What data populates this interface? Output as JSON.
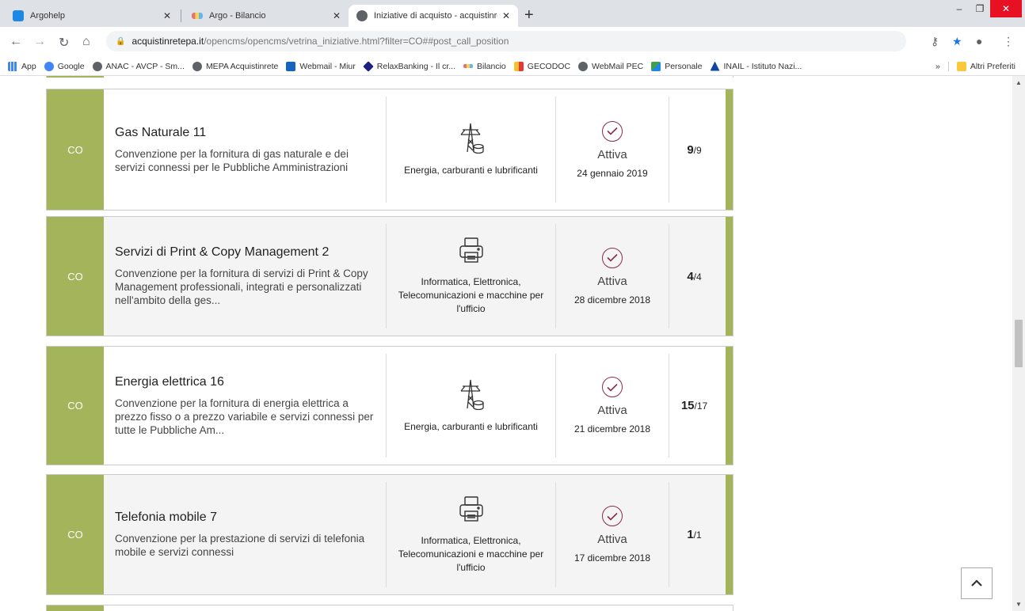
{
  "browser": {
    "tabs": [
      {
        "title": "Argohelp",
        "active": false
      },
      {
        "title": "Argo - Bilancio",
        "active": false
      },
      {
        "title": "Iniziative di acquisto - acquistinre",
        "active": true
      }
    ],
    "new_tab": "+",
    "url_host": "acquistinretepa.it",
    "url_path": "/opencms/opencms/vetrina_iniziative.html?filter=CO##post_call_position",
    "bookmarks": [
      "App",
      "Google",
      "ANAC - AVCP - Sm...",
      "MEPA Acquistinrete",
      "Webmail - Miur",
      "RelaxBanking - Il cr...",
      "Bilancio",
      "GECODOC",
      "WebMail PEC",
      "Personale",
      "INAIL - Istituto Nazi...",
      "Altri Preferiti"
    ],
    "bookmarks_overflow": "»"
  },
  "cards": [
    {
      "badge": "CO",
      "title": "Gas Naturale 11",
      "desc": "Convenzione per la fornitura di gas naturale e dei servizi connessi per le Pubbliche Amministrazioni",
      "category": "Energia, carburanti e lubrificanti",
      "category_icon": "electricity-pylon-icon",
      "status": "Attiva",
      "date": "24 gennaio 2019",
      "count": "9",
      "total": "/9"
    },
    {
      "badge": "CO",
      "title": "Servizi di Print & Copy Management 2",
      "desc": "Convenzione per la fornitura di servizi di Print & Copy Management professionali, integrati e personalizzati nell'ambito della ges...",
      "category": "Informatica, Elettronica, Telecomunicazioni e macchine per l'ufficio",
      "category_icon": "printer-icon",
      "status": "Attiva",
      "date": "28 dicembre 2018",
      "count": "4",
      "total": "/4"
    },
    {
      "badge": "CO",
      "title": "Energia elettrica 16",
      "desc": "Convenzione per la fornitura di energia elettrica a prezzo fisso o a prezzo variabile e servizi connessi per tutte le Pubbliche Am...",
      "category": "Energia, carburanti e lubrificanti",
      "category_icon": "electricity-pylon-icon",
      "status": "Attiva",
      "date": "21 dicembre 2018",
      "count": "15",
      "total": "/17"
    },
    {
      "badge": "CO",
      "title": "Telefonia mobile 7",
      "desc": "Convenzione per la prestazione di servizi di telefonia mobile e servizi connessi",
      "category": "Informatica, Elettronica, Telecomunicazioni e macchine per l'ufficio",
      "category_icon": "printer-icon",
      "status": "Attiva",
      "date": "17 dicembre 2018",
      "count": "1",
      "total": "/1"
    }
  ],
  "colors": {
    "accent": "#a4b45b",
    "status": "#8a2c4c"
  }
}
